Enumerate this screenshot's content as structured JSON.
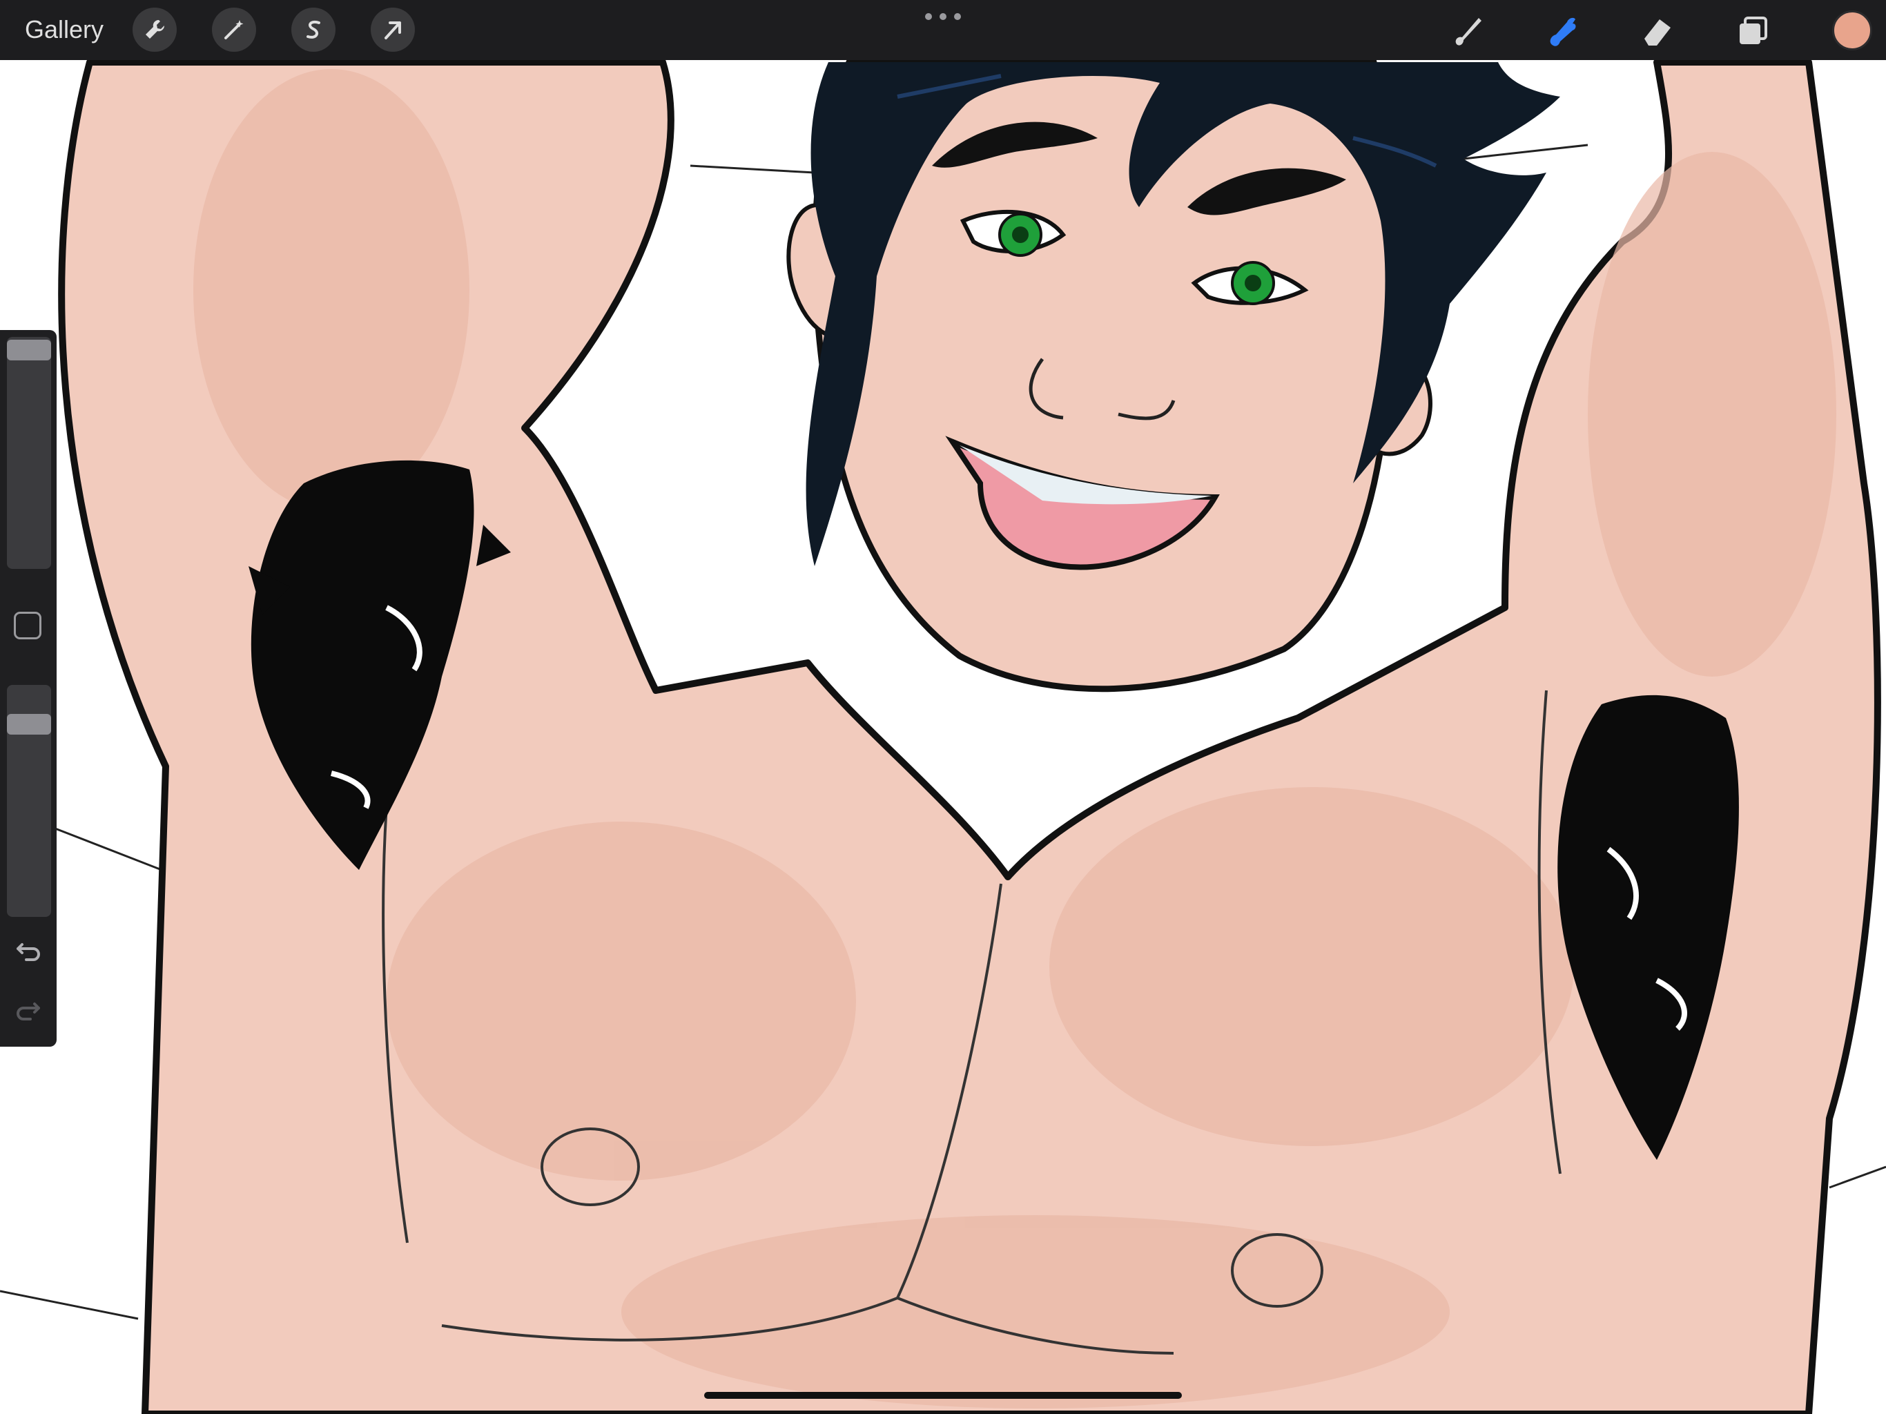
{
  "toolbar": {
    "gallery_label": "Gallery",
    "left_tools": [
      "wrench-icon",
      "magic-wand-icon",
      "selection-s-icon",
      "transform-arrow-icon"
    ],
    "right_tools": [
      "brush-icon",
      "smudge-icon",
      "eraser-icon",
      "layers-icon"
    ],
    "active_tool": "smudge-icon",
    "accent_color": "#2f7cf6",
    "current_color": "#e8a48c"
  },
  "sidebar": {
    "brush_size_level": 0.02,
    "opacity_level": 0.15,
    "undo_icon": "undo-icon",
    "redo_icon": "redo-icon"
  },
  "canvas": {
    "skin_color": "#f2cbbd",
    "line_color": "#111111",
    "hair_color": "#0d1b2b",
    "eye_color": "#1fa03a",
    "mouth_color": "#ef9aa5"
  }
}
